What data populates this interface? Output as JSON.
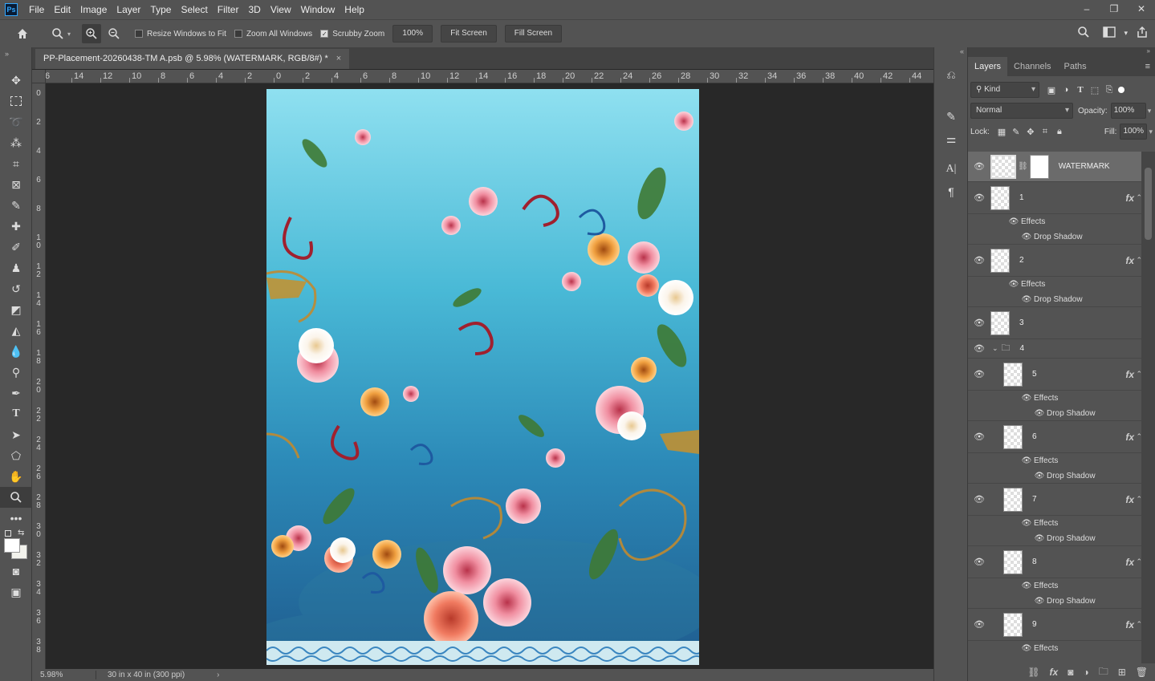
{
  "menubar": {
    "logo": "Ps",
    "items": [
      "File",
      "Edit",
      "Image",
      "Layer",
      "Type",
      "Select",
      "Filter",
      "3D",
      "View",
      "Window",
      "Help"
    ],
    "window_controls": [
      "–",
      "❐",
      "✕"
    ]
  },
  "options_bar": {
    "resize_windows_label": "Resize Windows to Fit",
    "resize_windows_checked": false,
    "zoom_all_label": "Zoom All Windows",
    "zoom_all_checked": false,
    "scrubby_label": "Scrubby Zoom",
    "scrubby_checked": true,
    "zoom_value": "100%",
    "fit_screen_label": "Fit Screen",
    "fill_screen_label": "Fill Screen"
  },
  "document": {
    "tab_title": "PP-Placement-20260438-TM A.psb @ 5.98% (WATERMARK, RGB/8#) *",
    "close": "×"
  },
  "ruler": {
    "h_ticks": [
      "6",
      "14",
      "12",
      "10",
      "8",
      "6",
      "4",
      "2",
      "0",
      "2",
      "4",
      "6",
      "8",
      "10",
      "12",
      "14",
      "16",
      "18",
      "20",
      "22",
      "24",
      "26",
      "28",
      "30",
      "32",
      "34",
      "36",
      "38",
      "40",
      "42",
      "44"
    ],
    "v_ticks": [
      "0",
      "2",
      "4",
      "6",
      "8",
      "10",
      "12",
      "14",
      "16",
      "18",
      "20",
      "22",
      "24",
      "26",
      "28",
      "30",
      "32",
      "34",
      "36",
      "38"
    ]
  },
  "status": {
    "zoom": "5.98%",
    "info": "30 in x 40 in (300 ppi)",
    "arrow": "›"
  },
  "panel": {
    "tabs": [
      "Layers",
      "Channels",
      "Paths"
    ],
    "active_tab": "Layers",
    "kind_label": "Kind",
    "blend_mode": "Normal",
    "opacity_label": "Opacity:",
    "opacity_value": "100%",
    "lock_label": "Lock:",
    "fill_label": "Fill:",
    "fill_value": "100%",
    "layers": [
      {
        "name": "WATERMARK"
      },
      {
        "name": "1",
        "fx": "fx",
        "effects": "Effects",
        "effect": "Drop Shadow"
      },
      {
        "name": "2",
        "fx": "fx",
        "effects": "Effects",
        "effect": "Drop Shadow"
      },
      {
        "name": "3"
      },
      {
        "name": "4"
      },
      {
        "name": "5",
        "fx": "fx",
        "effects": "Effects",
        "effect": "Drop Shadow"
      },
      {
        "name": "6",
        "fx": "fx",
        "effects": "Effects",
        "effect": "Drop Shadow"
      },
      {
        "name": "7",
        "fx": "fx",
        "effects": "Effects",
        "effect": "Drop Shadow"
      },
      {
        "name": "8",
        "fx": "fx",
        "effects": "Effects",
        "effect": "Drop Shadow"
      },
      {
        "name": "9",
        "fx": "fx",
        "effects": "Effects"
      }
    ]
  },
  "colors": {
    "accent": "#31a8ff",
    "chrome": "#535353",
    "canvas_bg": "#282828"
  }
}
